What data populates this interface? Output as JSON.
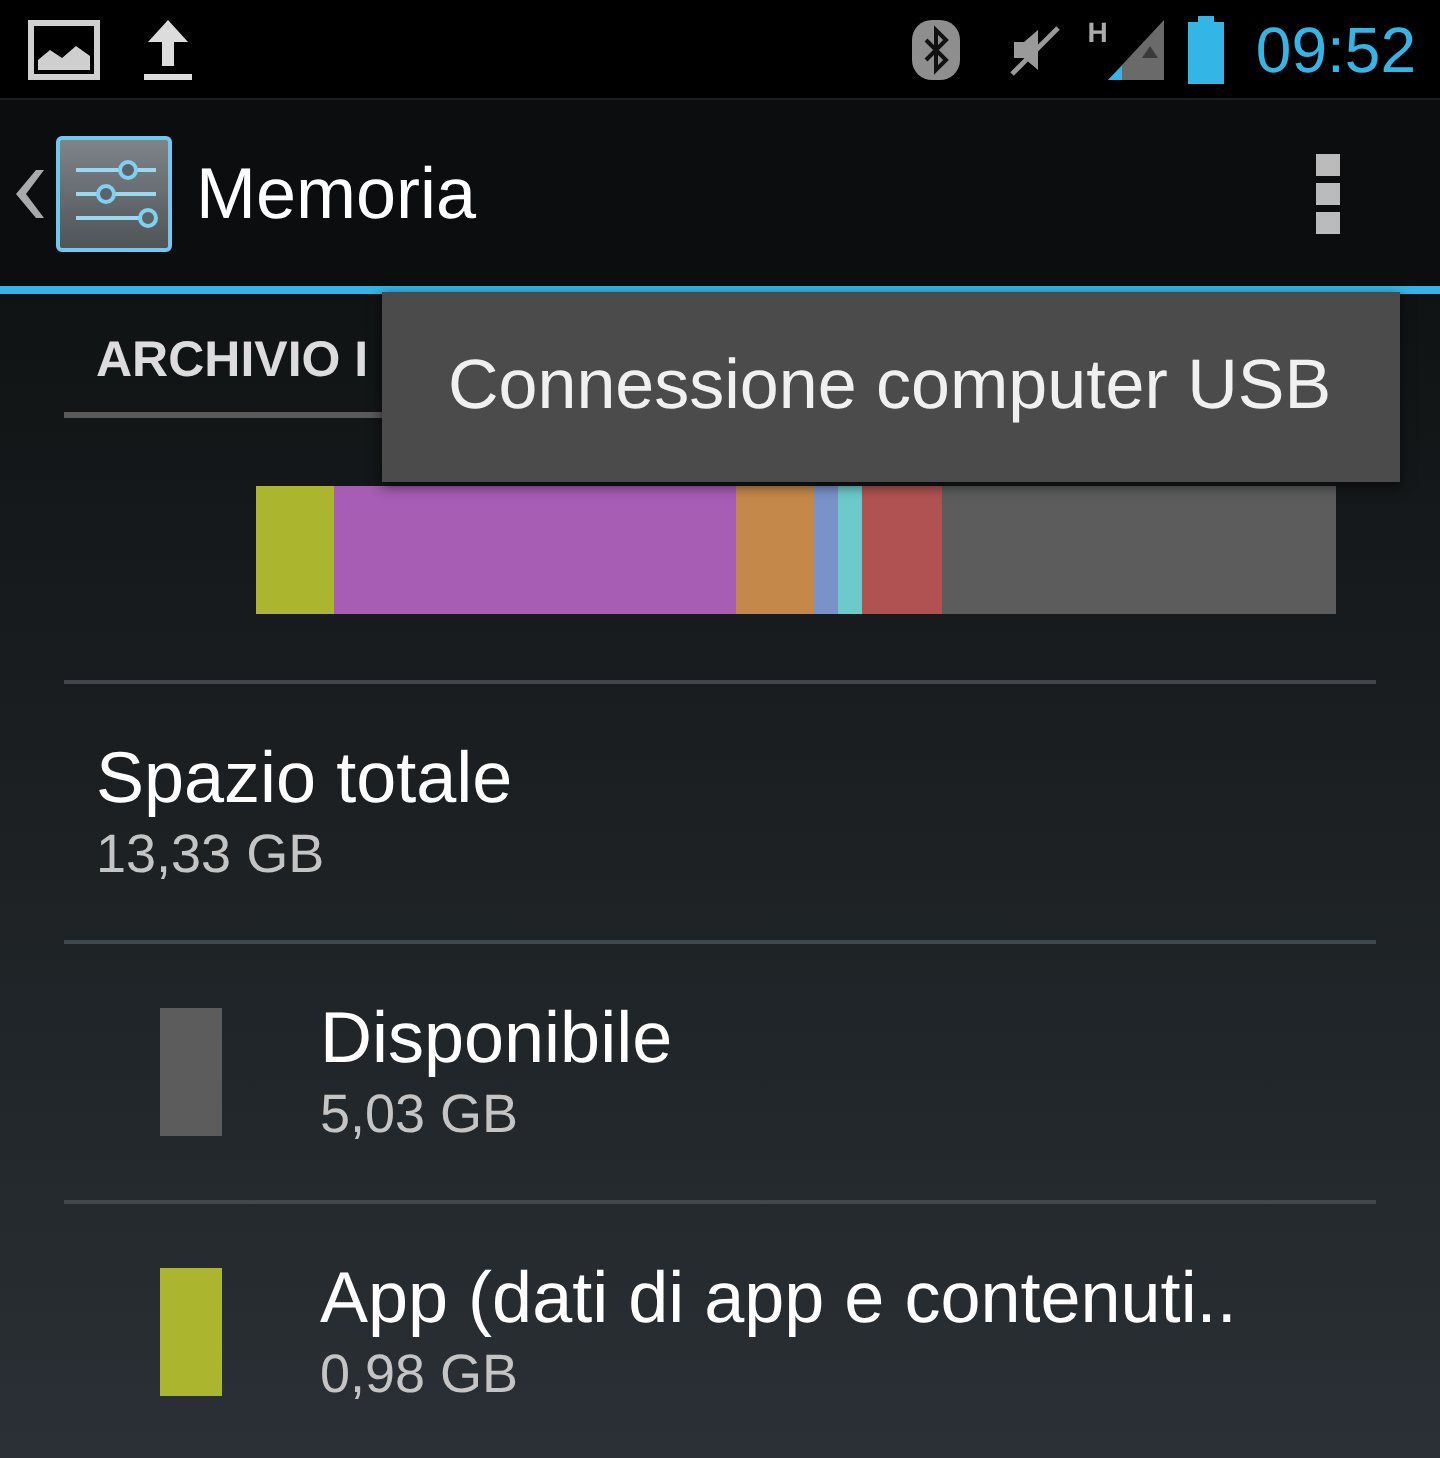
{
  "status_bar": {
    "network_type": "H",
    "time": "09:52"
  },
  "action_bar": {
    "title": "Memoria"
  },
  "overflow_menu": {
    "items": [
      {
        "label": "Connessione computer USB"
      }
    ]
  },
  "section_header": "ARCHIVIO I",
  "usage_bar": {
    "segments": [
      {
        "color": "#abb62e"
      },
      {
        "color": "#a65db3"
      },
      {
        "color": "#c4884a"
      },
      {
        "color": "#7a92c8"
      },
      {
        "color": "#6ccaca"
      },
      {
        "color": "#b05252"
      },
      {
        "color": "#5c5c5c"
      }
    ]
  },
  "total": {
    "title": "Spazio totale",
    "value": "13,33 GB"
  },
  "categories": [
    {
      "title": "Disponibile",
      "value": "5,03 GB",
      "color": "#5c5c5c"
    },
    {
      "title": "App (dati di app e contenuti..",
      "value": "0,98 GB",
      "color": "#abb62e"
    }
  ]
}
